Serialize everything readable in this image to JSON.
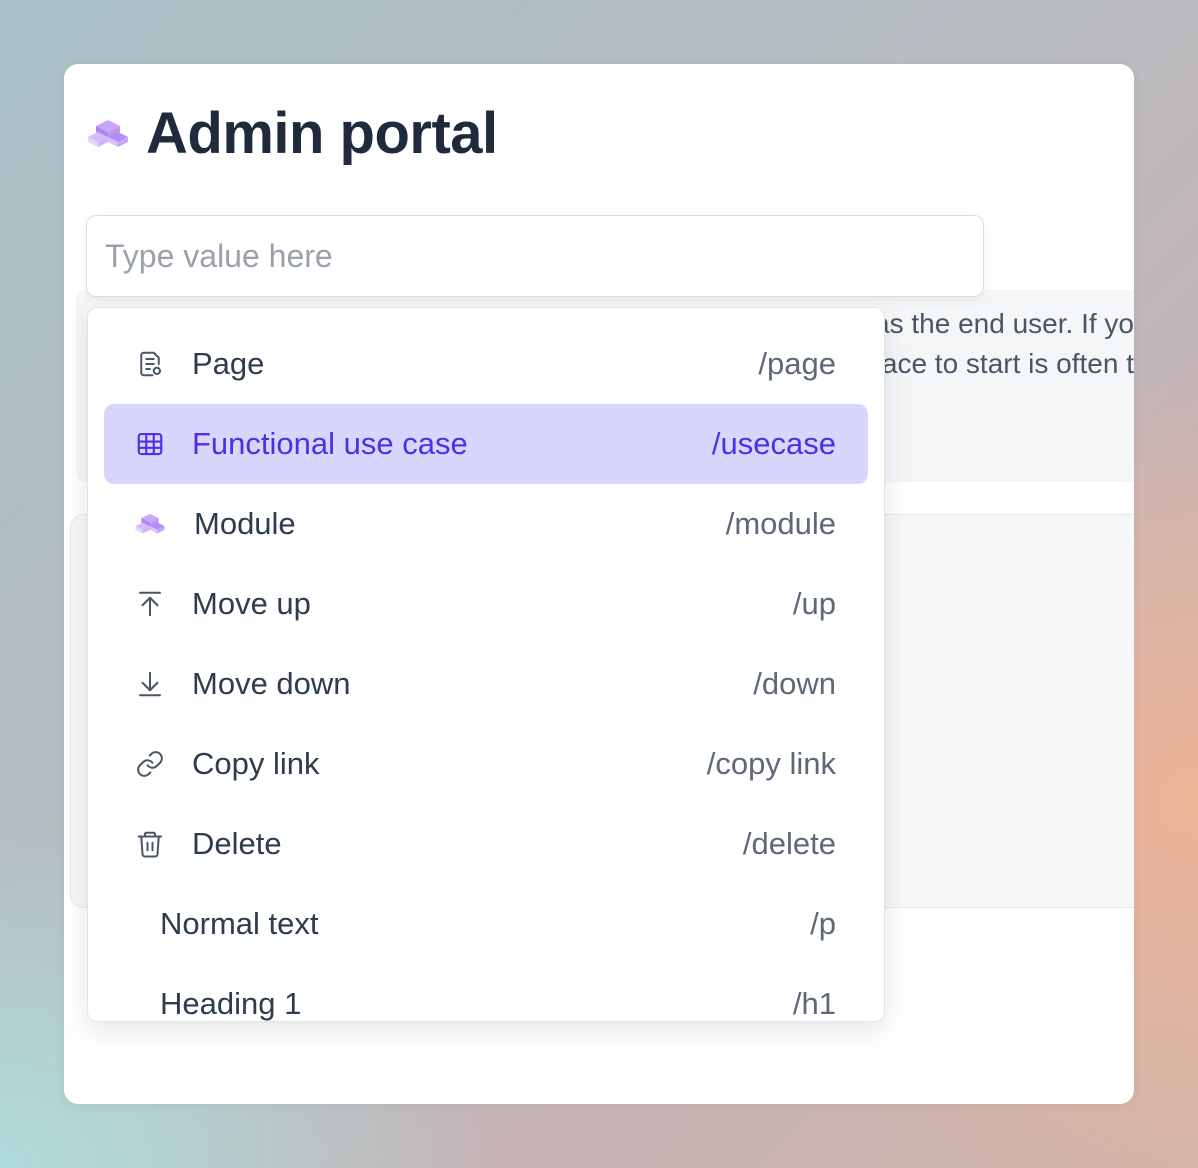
{
  "page": {
    "title": "Admin portal",
    "title_icon": "module-cubes-icon"
  },
  "search": {
    "placeholder": "Type value here",
    "value": ""
  },
  "info": {
    "line1": "This module is designed as the end user. If yo",
    "line2": "If the place to start is often t"
  },
  "menu": {
    "items": [
      {
        "label": "Page",
        "shortcut": "/page",
        "icon": "page-icon",
        "active": false
      },
      {
        "label": "Functional use case",
        "shortcut": "/usecase",
        "icon": "grid-table-icon",
        "active": true
      },
      {
        "label": "Module",
        "shortcut": "/module",
        "icon": "module-cubes-icon",
        "active": false
      },
      {
        "label": "Move up",
        "shortcut": "/up",
        "icon": "arrow-up-to-line-icon",
        "active": false
      },
      {
        "label": "Move down",
        "shortcut": "/down",
        "icon": "arrow-down-to-line-icon",
        "active": false
      },
      {
        "label": "Copy link",
        "shortcut": "/copy link",
        "icon": "link-icon",
        "active": false
      },
      {
        "label": "Delete",
        "shortcut": "/delete",
        "icon": "trash-icon",
        "active": false
      },
      {
        "label": "Normal text",
        "shortcut": "/p",
        "icon": "",
        "active": false
      },
      {
        "label": "Heading 1",
        "shortcut": "/h1",
        "icon": "",
        "active": false
      }
    ]
  },
  "colors": {
    "accent": "#4d2fe6",
    "active_bg": "#d9d6fd",
    "title": "#1f2a3d",
    "module_icon": "#b48cf5"
  }
}
